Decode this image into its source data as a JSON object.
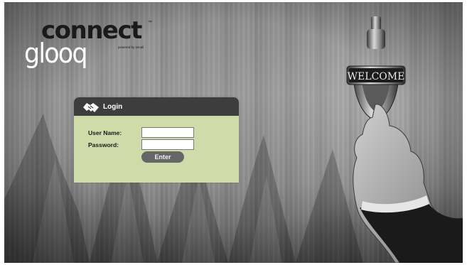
{
  "brand": {
    "logo_top": "connect",
    "logo_tm": "™",
    "logo_bottom": "glooq",
    "powered_by": "powered by Ismail",
    "knocker_sign": "WELCOME"
  },
  "login": {
    "title": "Login",
    "icon": "handshake-icon",
    "username_label": "User Name:",
    "username_value": "",
    "password_label": "Password:",
    "password_value": "",
    "enter_label": "Enter"
  },
  "colors": {
    "panel_bg": "#cfdcaa",
    "panel_header": "#3d3d3d",
    "button_bg": "#666666"
  }
}
